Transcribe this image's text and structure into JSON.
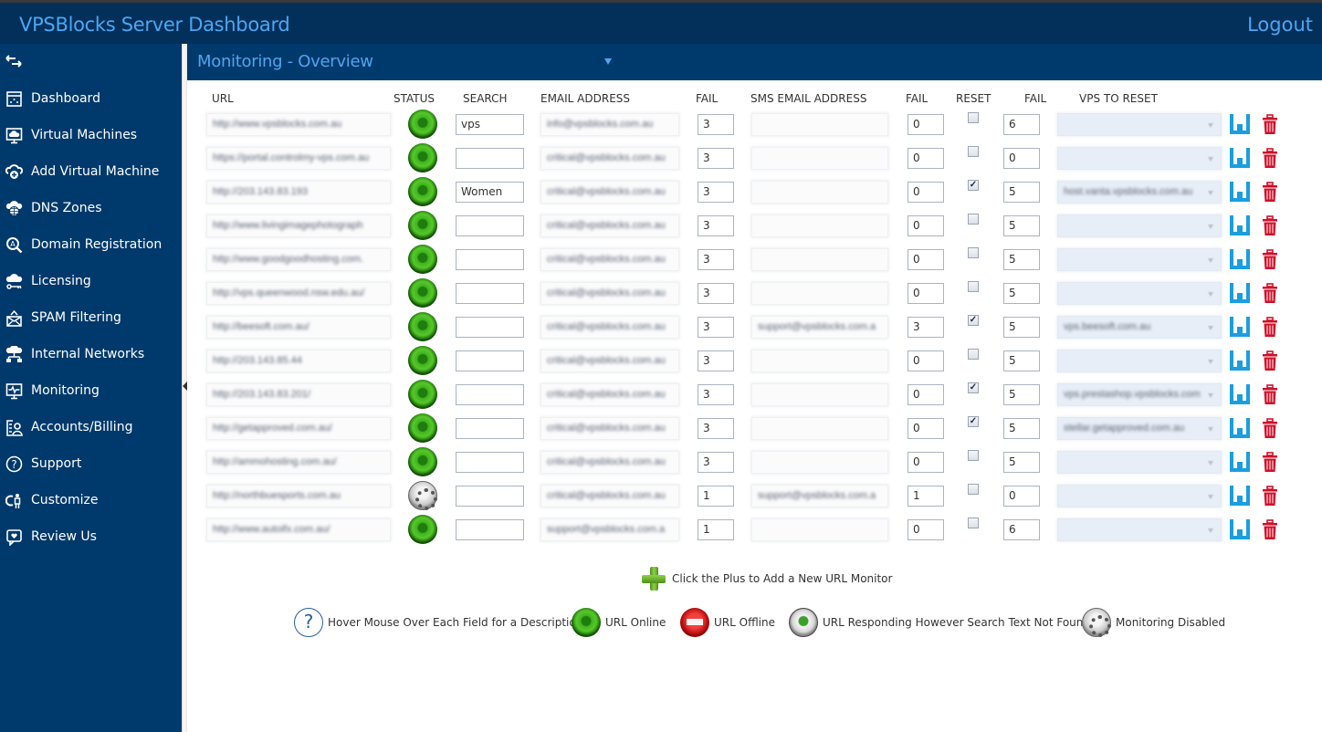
{
  "header": {
    "app_title": "VPSBlocks Server Dashboard",
    "logout_label": "Logout"
  },
  "sidebar": {
    "toggle_icon": "expand-collapse-arrows-icon",
    "items": [
      {
        "label": "Dashboard",
        "icon": "dashboard-icon"
      },
      {
        "label": "Virtual Machines",
        "icon": "monitor-cloud-icon"
      },
      {
        "label": "Add Virtual Machine",
        "icon": "cloud-add-icon"
      },
      {
        "label": "DNS Zones",
        "icon": "cloud-globe-icon"
      },
      {
        "label": "Domain Registration",
        "icon": "search-domain-icon"
      },
      {
        "label": "Licensing",
        "icon": "cloud-key-icon"
      },
      {
        "label": "SPAM Filtering",
        "icon": "mail-filter-icon"
      },
      {
        "label": "Internal Networks",
        "icon": "cloud-network-icon"
      },
      {
        "label": "Monitoring",
        "icon": "monitor-pulse-icon"
      },
      {
        "label": "Accounts/Billing",
        "icon": "account-billing-icon"
      },
      {
        "label": "Support",
        "icon": "help-circle-icon"
      },
      {
        "label": "Customize",
        "icon": "customize-icon"
      },
      {
        "label": "Review Us",
        "icon": "review-chat-icon"
      }
    ]
  },
  "main": {
    "title": "Monitoring - Overview",
    "columns": {
      "url": "URL",
      "status": "STATUS",
      "search": "SEARCH",
      "email": "EMAIL ADDRESS",
      "fail1": "FAIL",
      "sms": "SMS EMAIL ADDRESS",
      "fail2": "FAIL",
      "reset": "RESET",
      "fail3": "FAIL",
      "vps": "VPS TO RESET"
    },
    "rows": [
      {
        "url": "http://www.vpsblocks.com.au",
        "status": "online",
        "search": "vps",
        "email": "info@vpsblocks.com.au",
        "fail1": "3",
        "sms": "",
        "fail2": "0",
        "reset": false,
        "fail3": "6",
        "vps": ""
      },
      {
        "url": "https://portal.controlmy-vps.com.au",
        "status": "online",
        "search": "",
        "email": "critical@vpsblocks.com.au",
        "fail1": "3",
        "sms": "",
        "fail2": "0",
        "reset": false,
        "fail3": "0",
        "vps": ""
      },
      {
        "url": "http://203.143.83.193",
        "status": "online",
        "search": "Women",
        "email": "critical@vpsblocks.com.au",
        "fail1": "3",
        "sms": "",
        "fail2": "0",
        "reset": true,
        "fail3": "5",
        "vps": "host.vanta.vpsblocks.com.au"
      },
      {
        "url": "http://www.livingimagephotograph",
        "status": "online",
        "search": "",
        "email": "critical@vpsblocks.com.au",
        "fail1": "3",
        "sms": "",
        "fail2": "0",
        "reset": false,
        "fail3": "5",
        "vps": ""
      },
      {
        "url": "http://www.goodgoodhosting.com.",
        "status": "online",
        "search": "",
        "email": "critical@vpsblocks.com.au",
        "fail1": "3",
        "sms": "",
        "fail2": "0",
        "reset": false,
        "fail3": "5",
        "vps": ""
      },
      {
        "url": "http://vps.queenwood.nsw.edu.au/",
        "status": "online",
        "search": "",
        "email": "critical@vpsblocks.com.au",
        "fail1": "3",
        "sms": "",
        "fail2": "0",
        "reset": false,
        "fail3": "5",
        "vps": ""
      },
      {
        "url": "http://beesoft.com.au/",
        "status": "online",
        "search": "",
        "email": "critical@vpsblocks.com.au",
        "fail1": "3",
        "sms": "support@vpsblocks.com.a",
        "fail2": "3",
        "reset": true,
        "fail3": "5",
        "vps": "vps.beesoft.com.au"
      },
      {
        "url": "http://203.143.85.44",
        "status": "online",
        "search": "",
        "email": "critical@vpsblocks.com.au",
        "fail1": "3",
        "sms": "",
        "fail2": "0",
        "reset": false,
        "fail3": "5",
        "vps": ""
      },
      {
        "url": "http://203.143.83.201/",
        "status": "online",
        "search": "",
        "email": "critical@vpsblocks.com.au",
        "fail1": "3",
        "sms": "",
        "fail2": "0",
        "reset": true,
        "fail3": "5",
        "vps": "vps.prestashop.vpsblocks.com"
      },
      {
        "url": "http://getapproved.com.au/",
        "status": "online",
        "search": "",
        "email": "critical@vpsblocks.com.au",
        "fail1": "3",
        "sms": "",
        "fail2": "0",
        "reset": true,
        "fail3": "5",
        "vps": "stellar.getapproved.com.au"
      },
      {
        "url": "http://ammohosting.com.au/",
        "status": "online",
        "search": "",
        "email": "critical@vpsblocks.com.au",
        "fail1": "3",
        "sms": "",
        "fail2": "0",
        "reset": false,
        "fail3": "5",
        "vps": ""
      },
      {
        "url": "http://northbuesports.com.au",
        "status": "disabled",
        "search": "",
        "email": "critical@vpsblocks.com.au",
        "fail1": "1",
        "sms": "support@vpsblocks.com.a",
        "fail2": "1",
        "reset": false,
        "fail3": "0",
        "vps": ""
      },
      {
        "url": "http://www.autoifx.com.au/",
        "status": "online",
        "search": "",
        "email": "support@vpsblocks.com.a",
        "fail1": "1",
        "sms": "",
        "fail2": "0",
        "reset": false,
        "fail3": "6",
        "vps": ""
      }
    ],
    "add_monitor_label": "Click the Plus to Add a New URL Monitor",
    "legend": [
      {
        "icon": "help-circle-icon",
        "label": "Hover Mouse Over Each Field for a Description"
      },
      {
        "icon": "status-online-icon",
        "label": "URL Online"
      },
      {
        "icon": "status-offline-icon",
        "label": "URL Offline"
      },
      {
        "icon": "status-responding-icon",
        "label": "URL Responding However Search Text Not Found"
      },
      {
        "icon": "status-disabled-icon",
        "label": "Monitoring Disabled"
      }
    ],
    "colors": {
      "save": "#1a9ee0",
      "delete": "#d0102a",
      "brand": "#00396b",
      "accent": "#4ea5f0"
    }
  }
}
